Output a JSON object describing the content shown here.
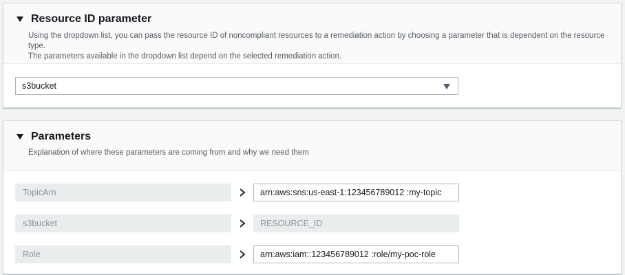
{
  "resource_panel": {
    "title": "Resource ID parameter",
    "description_line1": "Using the dropdown list, you can pass the resource ID of noncompliant resources to a remediation action by choosing a parameter that is dependent on the resource type.",
    "description_line2": "The parameters available in the dropdown list depend on the selected remediation action.",
    "selected_value": "s3bucket"
  },
  "parameters_panel": {
    "title": "Parameters",
    "description": "Explanation of where these parameters are coming from and why we need them",
    "rows": [
      {
        "key": "TopicArn",
        "value": "arn:aws:sns:us-east-1:123456789012  :my-topic",
        "editable": true
      },
      {
        "key": "s3bucket",
        "value": "RESOURCE_ID",
        "editable": false
      },
      {
        "key": "Role",
        "value": "arn:aws:iam::123456789012  :role/my-poc-role",
        "editable": true
      }
    ]
  },
  "icons": {
    "collapse": "caret-down-icon",
    "dropdown": "dropdown-arrow-icon",
    "row_separator": "chevron-right-icon"
  }
}
